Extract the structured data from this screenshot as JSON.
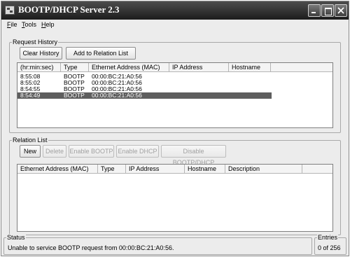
{
  "window": {
    "title": "BOOTP/DHCP Server 2.3"
  },
  "menu": {
    "items": [
      {
        "label": "File",
        "mnemonic": "F",
        "rest": "ile"
      },
      {
        "label": "Tools",
        "mnemonic": "T",
        "rest": "ools"
      },
      {
        "label": "Help",
        "mnemonic": "H",
        "rest": "elp"
      }
    ]
  },
  "request_history": {
    "title": "Request History",
    "clear_label": "Clear History",
    "add_label": "Add to Relation List",
    "columns": [
      "(hr:min:sec)",
      "Type",
      "Ethernet Address (MAC)",
      "IP Address",
      "Hostname"
    ],
    "rows": [
      {
        "time": "8:55:08",
        "type": "BOOTP",
        "mac": "00:00:BC:21:A0:56",
        "ip": "",
        "hostname": ""
      },
      {
        "time": "8:55:02",
        "type": "BOOTP",
        "mac": "00:00:BC:21:A0:56",
        "ip": "",
        "hostname": ""
      },
      {
        "time": "8:54:55",
        "type": "BOOTP",
        "mac": "00:00:BC:21:A0:56",
        "ip": "",
        "hostname": ""
      },
      {
        "time": "8:54:49",
        "type": "BOOTP",
        "mac": "00:00:BC:21:A0:56",
        "ip": "",
        "hostname": "",
        "selected": true
      }
    ]
  },
  "relation_list": {
    "title": "Relation List",
    "buttons": {
      "new": "New",
      "delete": "Delete",
      "enable_bootp": "Enable BOOTP",
      "enable_dhcp": "Enable DHCP",
      "disable": "Disable BOOTP/DHCP"
    },
    "columns": [
      "Ethernet Address (MAC)",
      "Type",
      "IP Address",
      "Hostname",
      "Description"
    ]
  },
  "status": {
    "title": "Status",
    "message": "Unable to service BOOTP request from 00:00:BC:21:A0:56."
  },
  "entries": {
    "title": "Entries",
    "value": "0 of 256"
  },
  "colors": {
    "titlebar": "#2b2b2b",
    "selection": "#5e5e5e",
    "window_bg": "#ececec"
  }
}
